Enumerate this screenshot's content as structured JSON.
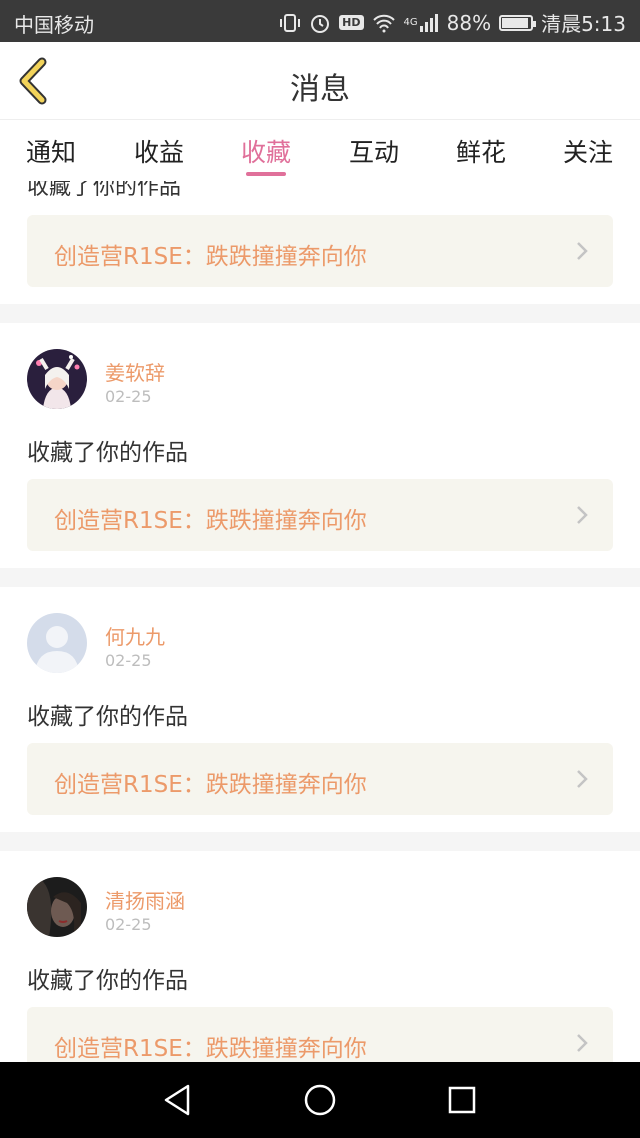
{
  "status_bar": {
    "carrier": "中国移动",
    "network": "4G",
    "battery_percent": "88%",
    "time": "清晨5:13",
    "icons": [
      "vibrate-icon",
      "alarm-icon",
      "hd-icon",
      "wifi-icon",
      "signal-icon",
      "battery-icon"
    ]
  },
  "header": {
    "title": "消息",
    "back_icon": "chevron-left-icon"
  },
  "tabs": [
    {
      "label": "通知"
    },
    {
      "label": "收益"
    },
    {
      "label": "收藏",
      "active": true
    },
    {
      "label": "互动"
    },
    {
      "label": "鲜花"
    },
    {
      "label": "关注"
    }
  ],
  "feed": {
    "partial_first_item": {
      "action": "收藏了你的作品",
      "work_title": "创造营R1SE：跌跌撞撞奔向你"
    },
    "items": [
      {
        "user": "姜软辞",
        "date": "02-25",
        "action": "收藏了你的作品",
        "work_title": "创造营R1SE：跌跌撞撞奔向你"
      },
      {
        "user": "何九九",
        "date": "02-25",
        "action": "收藏了你的作品",
        "work_title": "创造营R1SE：跌跌撞撞奔向你"
      },
      {
        "user": "清扬雨涵",
        "date": "02-25",
        "action": "收藏了你的作品",
        "work_title": "创造营R1SE：跌跌撞撞奔向你"
      }
    ]
  },
  "colors": {
    "accent_pink": "#e0709a",
    "name_orange": "#ec9a6a",
    "link_bg": "#f6f5ee",
    "status_bar_bg": "#3a3a3a"
  },
  "nav_bar": {
    "icons": [
      "back-triangle-icon",
      "home-circle-icon",
      "recents-square-icon"
    ]
  }
}
